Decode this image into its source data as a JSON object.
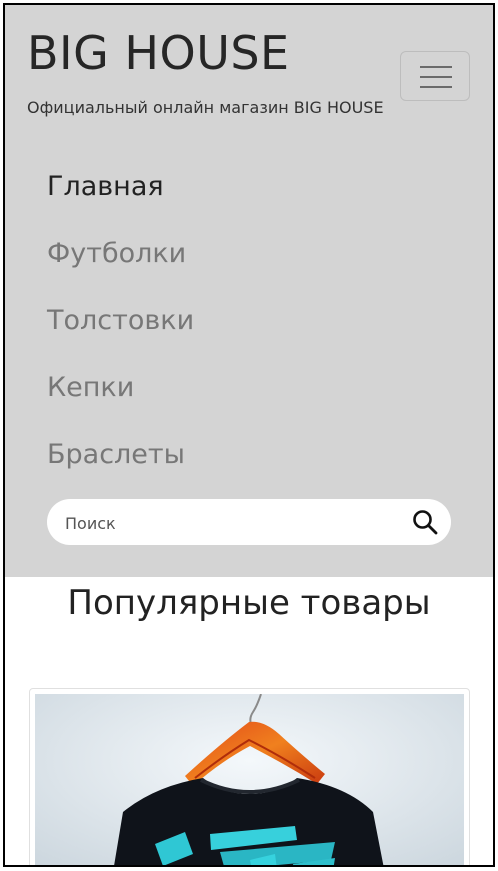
{
  "header": {
    "brand": "BIG HOUSE",
    "tagline": "Официальный онлайн магазин BIG HOUSE"
  },
  "nav": {
    "items": [
      {
        "label": "Главная",
        "active": true
      },
      {
        "label": "Футболки",
        "active": false
      },
      {
        "label": "Толстовки",
        "active": false
      },
      {
        "label": "Кепки",
        "active": false
      },
      {
        "label": "Браслеты",
        "active": false
      }
    ]
  },
  "search": {
    "placeholder": "Поиск",
    "value": ""
  },
  "main": {
    "section_title": "Популярные товары"
  },
  "colors": {
    "header_bg": "#d4d4d4",
    "brand_text": "#262626",
    "nav_inactive": "#777777",
    "nav_active": "#222222"
  },
  "icons": {
    "menu": "hamburger-icon",
    "search": "magnifier-icon"
  }
}
